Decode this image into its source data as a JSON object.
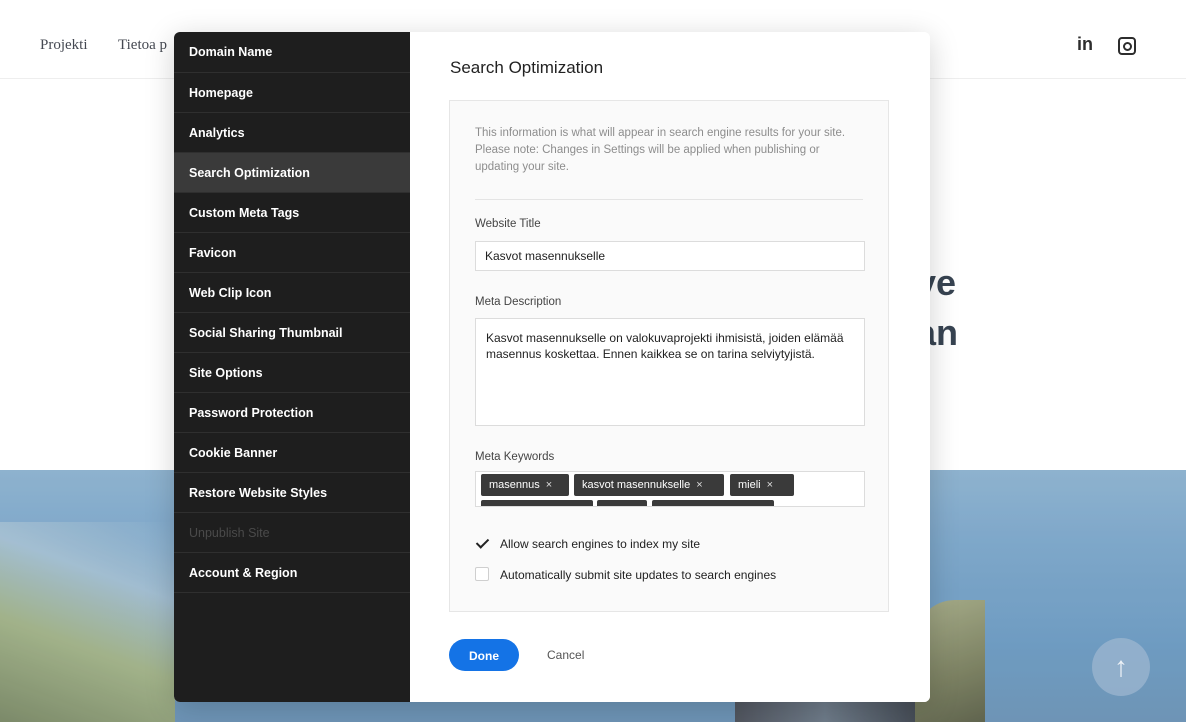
{
  "site": {
    "nav": [
      "Projekti",
      "Tietoa p"
    ],
    "social": {
      "linkedin": "in"
    },
    "hero_lines": [
      "ve",
      "an"
    ],
    "scroll_top_symbol": "↑"
  },
  "sidebar": {
    "items": [
      {
        "label": "Domain Name"
      },
      {
        "label": "Homepage"
      },
      {
        "label": "Analytics"
      },
      {
        "label": "Search Optimization"
      },
      {
        "label": "Custom Meta Tags"
      },
      {
        "label": "Favicon"
      },
      {
        "label": "Web Clip Icon"
      },
      {
        "label": "Social Sharing Thumbnail"
      },
      {
        "label": "Site Options"
      },
      {
        "label": "Password Protection"
      },
      {
        "label": "Cookie Banner"
      },
      {
        "label": "Restore Website Styles"
      },
      {
        "label": "Unpublish Site"
      },
      {
        "label": "Account & Region"
      }
    ]
  },
  "content": {
    "title": "Search Optimization",
    "info": "This information is what will appear in search engine results for your site. Please note: Changes in Settings will be applied when publishing or updating your site.",
    "website_title_label": "Website Title",
    "website_title_value": "Kasvot masennukselle",
    "meta_description_label": "Meta Description",
    "meta_description_value": "Kasvot masennukselle on valokuvaprojekti ihmisistä, joiden elämää masennus koskettaa. Ennen kaikkea se on tarina selviytyjistä.",
    "meta_keywords_label": "Meta Keywords",
    "keywords": [
      "masennus",
      "kasvot masennukselle",
      "mieli"
    ],
    "keyword_remove": "×",
    "allow_index_label": "Allow search engines to index my site",
    "auto_submit_label": "Automatically submit site updates to search engines"
  },
  "actions": {
    "done": "Done",
    "cancel": "Cancel"
  }
}
